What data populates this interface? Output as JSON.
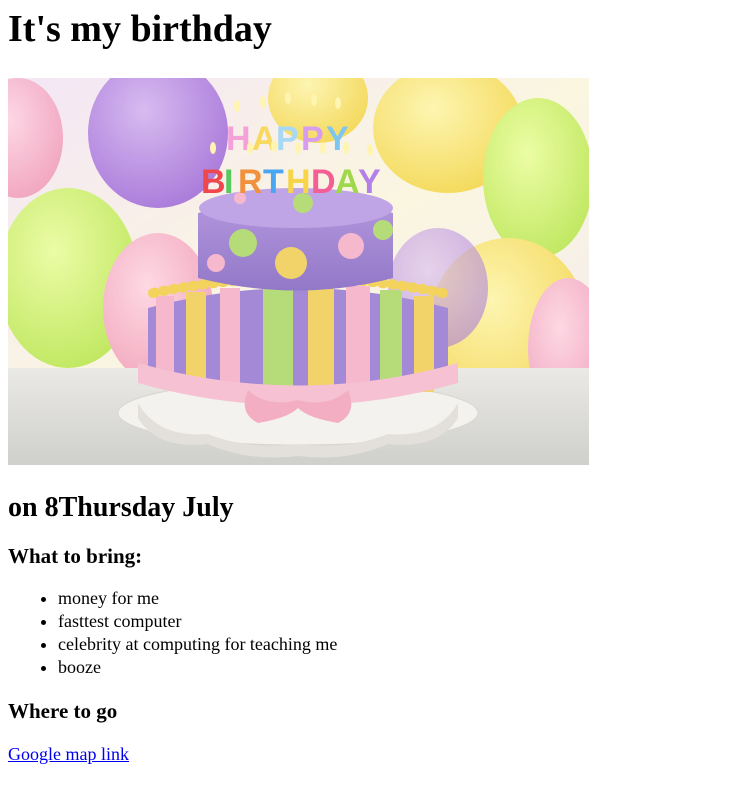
{
  "page": {
    "title": "It's my birthday",
    "date_heading": "on 8Thursday July",
    "bring_heading": "What to bring:",
    "bring_items": [
      "money for me",
      "fasttest computer",
      "celebrity at computing for teaching me",
      "booze"
    ],
    "where_heading": "Where to go",
    "map_link_text": "Google map link"
  },
  "image": {
    "alt": "Happy Birthday cake",
    "candle_text": [
      "HAPPY",
      "BIRTHDAY"
    ]
  },
  "colors": {
    "link": "#0000ee",
    "cake_top": "#a98bd6",
    "cake_bottom": "#9d7fd0",
    "ribbon": "#f4b8cc"
  }
}
